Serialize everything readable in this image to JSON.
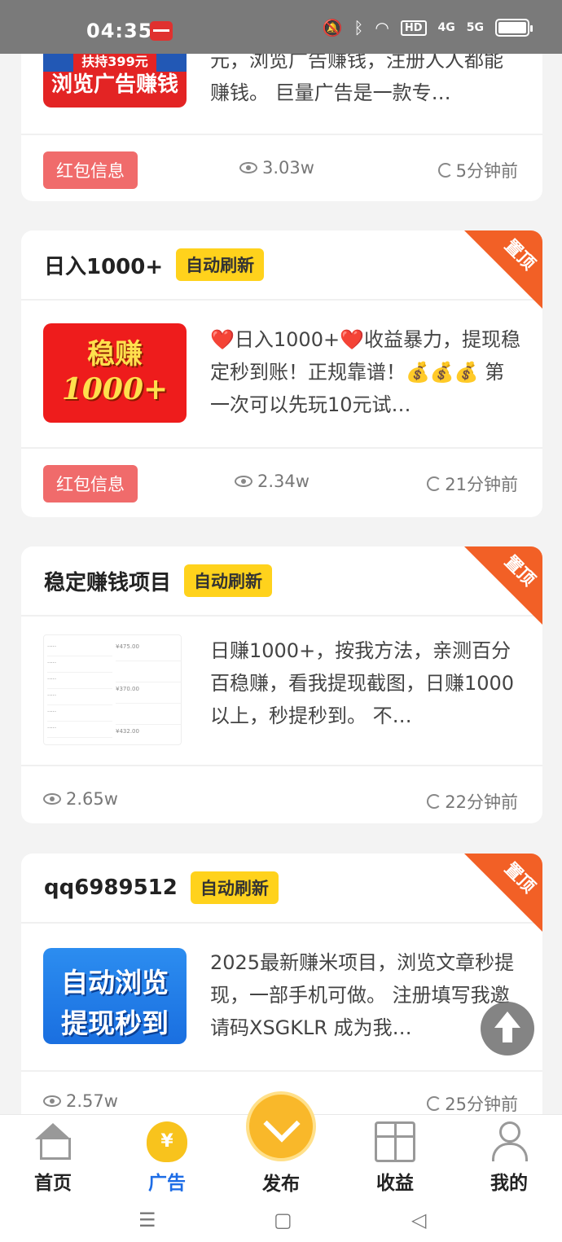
{
  "status_bar": {
    "time": "04:35",
    "icons": [
      "app-notification-icon",
      "mute-icon",
      "bluetooth-icon",
      "wifi-icon",
      "hd-icon",
      "4g-signal-icon",
      "5g-signal-icon",
      "battery-icon"
    ],
    "hd_label": "HD",
    "net_4g": "4G",
    "net_5g": "5G"
  },
  "cards": [
    {
      "thumb_top": "扶持399元",
      "thumb_main": "浏览广告赚钱",
      "desc": "元，浏览广告赚钱，注册人人都能赚钱。 巨量广告是一款专…",
      "badge": "红包信息",
      "views": "3.03w",
      "time": "5分钟前"
    },
    {
      "title": "日入1000+",
      "tag": "自动刷新",
      "ribbon": "置顶",
      "thumb_l1": "稳赚",
      "thumb_l2": "1000+",
      "desc": "❤️日入1000+❤️收益暴力，提现稳定秒到账！正规靠谱！💰💰💰 第一次可以先玩10元试…",
      "badge": "红包信息",
      "views": "2.34w",
      "time": "21分钟前"
    },
    {
      "title": "稳定赚钱项目",
      "tag": "自动刷新",
      "ribbon": "置顶",
      "thumb_values": [
        "¥475.00",
        "¥370.00",
        "¥432.00"
      ],
      "desc": "日赚1000+，按我方法，亲测百分百稳赚，看我提现截图，日赚1000以上，秒提秒到。 不…",
      "views": "2.65w",
      "time": "22分钟前"
    },
    {
      "title": "qq6989512",
      "tag": "自动刷新",
      "ribbon": "置顶",
      "thumb_l1": "自动浏览",
      "thumb_l2": "提现秒到",
      "desc": "2025最新赚米项目，浏览文章秒提现，一部手机可做。 注册填写我邀请码XSGKLR 成为我…",
      "views": "2.57w",
      "time": "25分钟前"
    }
  ],
  "tabbar": {
    "home": "首页",
    "ads": "广告",
    "ads_icon_char": "¥",
    "publish": "发布",
    "earnings": "收益",
    "mine": "我的"
  },
  "navbar": {
    "menu": "☰",
    "home": "▢",
    "back": "◁"
  },
  "colors": {
    "accent_blue": "#1e6de6",
    "tag_yellow": "#ffd21c",
    "ribbon_orange": "#f26026",
    "badge_red": "#f06b6b"
  }
}
